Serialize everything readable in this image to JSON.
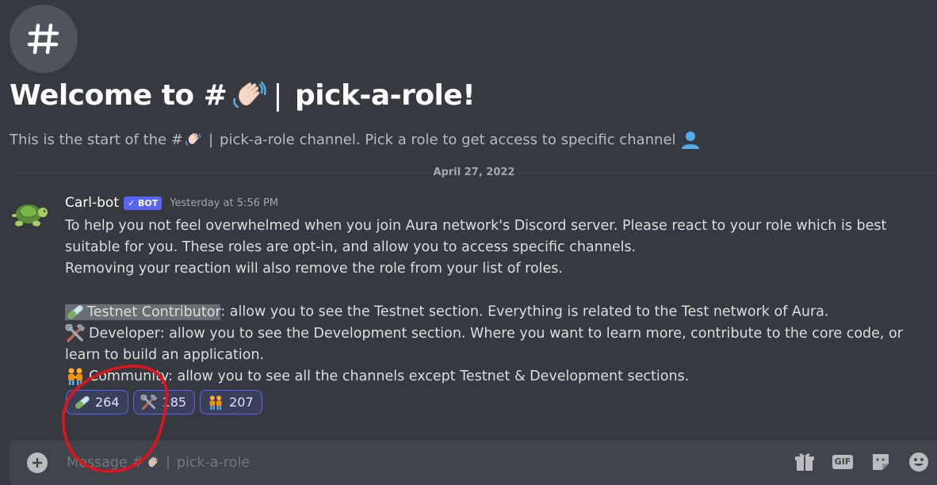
{
  "channel": {
    "icon": "hash-icon",
    "title_prefix": "Welcome to #",
    "title_sep": "|",
    "title_name": "pick-a-role!",
    "subtitle_start": "This is the start of the #",
    "subtitle_sep": "|",
    "subtitle_rest": "pick-a-role channel. Pick a role to get access to specific channel",
    "wave_emoji": "waving-hand-emoji",
    "person_emoji": "bust-silhouette-emoji"
  },
  "divider": {
    "date": "April 27, 2022"
  },
  "message": {
    "author": "Carl-bot",
    "bot_tag": "✓ BOT",
    "timestamp": "Yesterday at 5:56 PM",
    "avatar": "turtle-avatar",
    "lines": [
      "To help you not feel overwhelmed when you join Aura network's Discord server. Please react to your role which is best suitable for you. These roles are opt-in, and allow you to access specific channels.",
      "Removing your reaction will also remove the role from your list of roles."
    ],
    "roles": [
      {
        "emoji": "test-tube-emoji",
        "name": "Testnet Contributor",
        "desc": ": allow you to see the Testnet section. Everything is related to the Test network of Aura."
      },
      {
        "emoji": "hammer-and-wrench-emoji",
        "name": "Developer",
        "desc": ": allow you to see the Development section. Where you want to learn more, contribute to the core code, or learn to build an application."
      },
      {
        "emoji": "people-holding-hands-emoji",
        "name": "Community",
        "desc": ": allow you to see all the channels except Testnet & Development sections."
      }
    ],
    "reactions": [
      {
        "emoji": "test-tube-emoji",
        "count": "264"
      },
      {
        "emoji": "hammer-and-wrench-emoji",
        "count": "185"
      },
      {
        "emoji": "people-holding-hands-emoji",
        "count": "207"
      }
    ]
  },
  "composer": {
    "placeholder_start": "Message #",
    "placeholder_sep": "|",
    "placeholder_rest": "pick-a-role",
    "gif_label": "GIF",
    "icons": [
      "plus-circle-icon",
      "gift-icon",
      "gif-icon",
      "sticker-icon",
      "emoji-smile-icon"
    ]
  },
  "colors": {
    "background": "#36393f",
    "composer": "#40444b",
    "blurple": "#5865f2",
    "annotation": "#e3121b"
  }
}
